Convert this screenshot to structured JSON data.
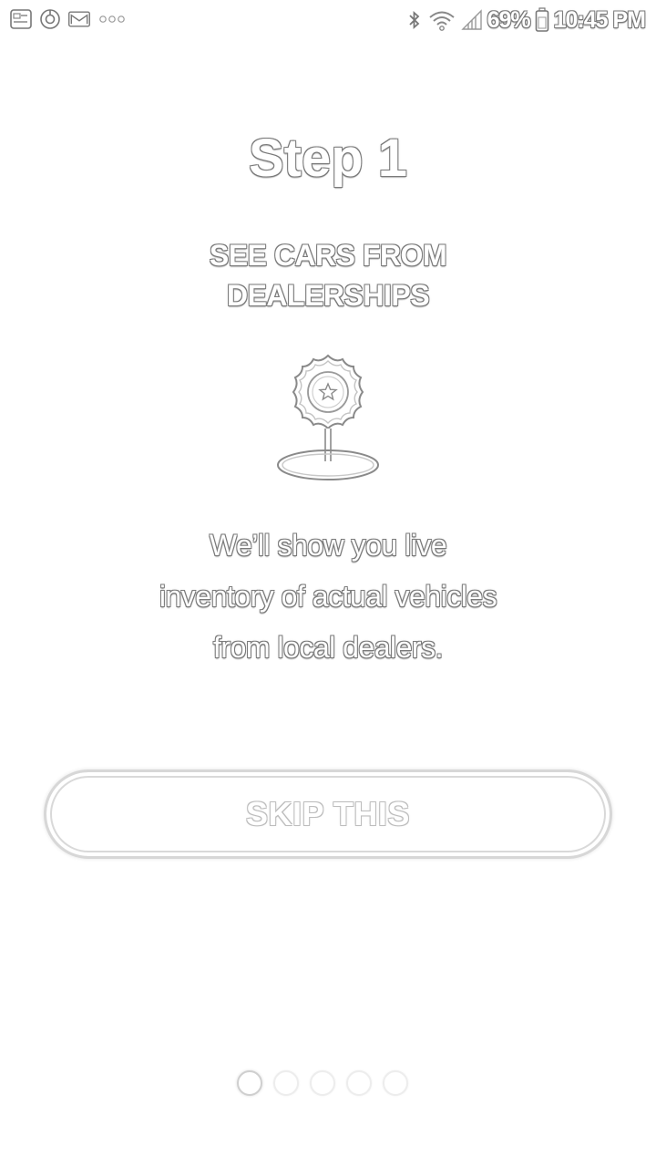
{
  "status_bar": {
    "notification_icons": [
      "image-notification-icon",
      "sync-icon",
      "gmail-icon",
      "more-notifications-icon"
    ],
    "bluetooth_icon": "bluetooth-icon",
    "wifi_icon": "wifi-icon",
    "signal_icon": "cell-signal-icon",
    "battery_percent": "69%",
    "battery_icon": "battery-icon",
    "time": "10:45 PM"
  },
  "onboarding": {
    "step_title": "Step 1",
    "heading_line1": "SEE CARS FROM",
    "heading_line2": "DEALERSHIPS",
    "illustration_icon": "dealer-location-badge-icon",
    "description_line1": "We’ll show you live",
    "description_line2": "inventory of actual vehicles",
    "description_line3": "from local dealers.",
    "skip_label": "SKIP THIS"
  },
  "pager": {
    "total": 5,
    "active_index": 0
  }
}
